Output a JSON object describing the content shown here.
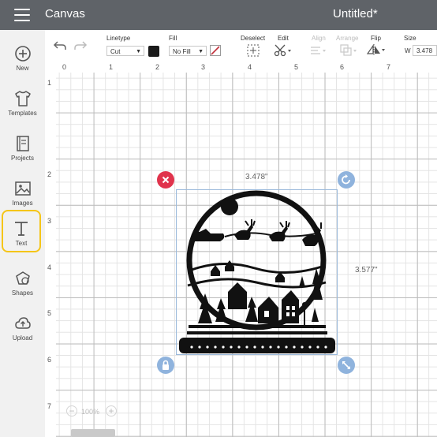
{
  "header": {
    "app_title": "Canvas",
    "doc_title": "Untitled*"
  },
  "sidebar": {
    "items": [
      {
        "label": "New",
        "icon": "plus-circle-icon"
      },
      {
        "label": "Templates",
        "icon": "tshirt-icon"
      },
      {
        "label": "Projects",
        "icon": "projects-icon"
      },
      {
        "label": "Images",
        "icon": "image-icon"
      },
      {
        "label": "Text",
        "icon": "text-icon",
        "active": true
      },
      {
        "label": "Shapes",
        "icon": "shapes-icon"
      },
      {
        "label": "Upload",
        "icon": "cloud-upload-icon"
      }
    ]
  },
  "toolbar": {
    "linetype_label": "Linetype",
    "linetype_value": "Cut",
    "fill_label": "Fill",
    "fill_value": "No Fill",
    "deselect_label": "Deselect",
    "edit_label": "Edit",
    "align_label": "Align",
    "arrange_label": "Arrange",
    "flip_label": "Flip",
    "size_label": "Size",
    "size_w_label": "W",
    "size_w_value": "3.478",
    "swatch_color": "#1a1a1a"
  },
  "rulers": {
    "top": [
      "0",
      "1",
      "2",
      "3",
      "4",
      "5",
      "6",
      "7"
    ],
    "left": [
      "1",
      "2",
      "3",
      "4",
      "5",
      "6",
      "7"
    ]
  },
  "selection": {
    "width_label": "3.478\"",
    "height_label": "3.577\""
  },
  "zoom": {
    "value": "100%"
  },
  "colors": {
    "topbar": "#5f6368",
    "delete_handle": "#e0334c",
    "handle": "#8fb3dd",
    "active_outline": "#f5c518"
  }
}
